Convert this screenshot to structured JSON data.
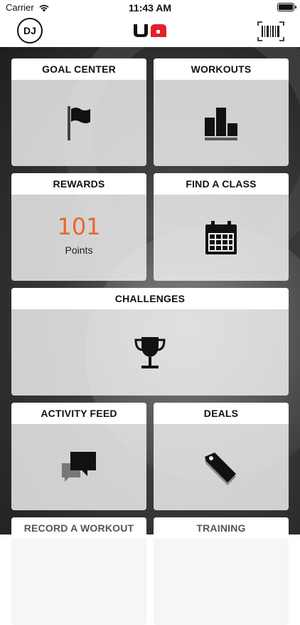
{
  "status": {
    "carrier": "Carrier",
    "time": "11:43 AM"
  },
  "nav": {
    "avatar_initials": "DJ",
    "logo_icon": "under-armour-logo",
    "barcode_icon": "barcode-icon"
  },
  "tiles": {
    "goal_center": {
      "label": "GOAL CENTER",
      "icon": "flag-icon"
    },
    "workouts": {
      "label": "WORKOUTS",
      "icon": "podium-icon"
    },
    "rewards": {
      "label": "REWARDS",
      "points": "101",
      "points_label": "Points"
    },
    "find_class": {
      "label": "FIND A CLASS",
      "icon": "calendar-icon"
    },
    "challenges": {
      "label": "CHALLENGES",
      "icon": "trophy-icon"
    },
    "activity_feed": {
      "label": "ACTIVITY FEED",
      "icon": "chat-bubbles-icon"
    },
    "deals": {
      "label": "DEALS",
      "icon": "tag-icon"
    },
    "record_workout": {
      "label": "RECORD A WORKOUT"
    },
    "training": {
      "label": "TRAINING"
    }
  },
  "colors": {
    "accent": "#e8672a",
    "logo_red": "#e3202a",
    "tile_header": "#ffffff",
    "text": "#111111"
  }
}
